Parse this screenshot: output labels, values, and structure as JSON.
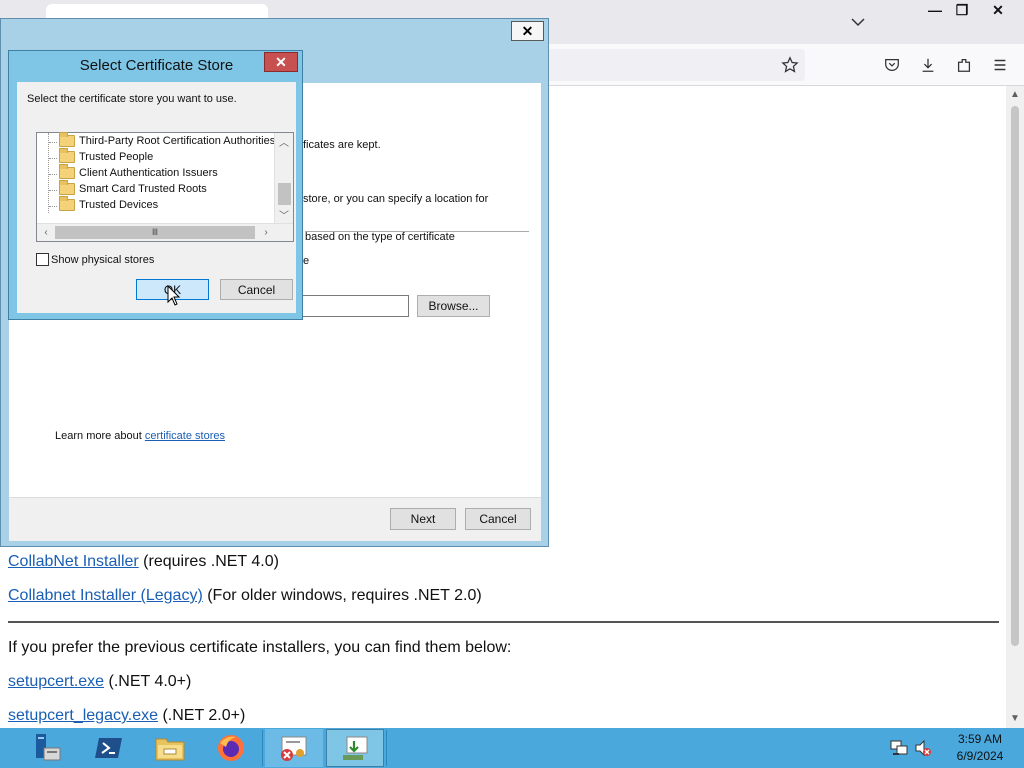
{
  "browser": {
    "window_controls": {
      "minimize": "—",
      "restore": "❐",
      "close": "✕"
    },
    "toolbar_icons": [
      "bookmark-star-icon",
      "pocket-icon",
      "downloads-icon",
      "extensions-icon",
      "menu-icon"
    ]
  },
  "page": {
    "lines": [
      {
        "link": "CollabNet Installer",
        "text": " (requires .NET 4.0)"
      },
      {
        "link": "Collabnet Installer (Legacy)",
        "text": " (For older windows, requires .NET 2.0)"
      },
      {
        "text": "If you prefer the previous certificate installers, you can find them below:"
      },
      {
        "link": "setupcert.exe",
        "text": " (.NET 4.0+)"
      },
      {
        "link": "setupcert_legacy.exe",
        "text": " (.NET 2.0+)"
      }
    ]
  },
  "wizard": {
    "close": "✕",
    "text_kept": "ficates are kept.",
    "text_store": "store, or you can specify a location for",
    "text_based": "based on the type of certificate",
    "text_e": "e",
    "browse_label": "Browse...",
    "learn_more": "Learn more about ",
    "learn_more_link": "certificate stores",
    "next_label": "Next",
    "cancel_label": "Cancel"
  },
  "cert_dialog": {
    "title": "Select Certificate Store",
    "close": "✕",
    "instruction": "Select the certificate store you want to use.",
    "stores": [
      "Third-Party Root Certification Authorities",
      "Trusted People",
      "Client Authentication Issuers",
      "Smart Card Trusted Roots",
      "Trusted Devices"
    ],
    "hscroll_grip": "Ⅲ",
    "show_physical": "Show physical stores",
    "show_physical_checked": false,
    "ok_label": "OK",
    "cancel_label": "Cancel"
  },
  "taskbar": {
    "items": [
      "server-manager-icon",
      "powershell-icon",
      "file-explorer-icon",
      "firefox-icon",
      "certificate-icon",
      "certificate-import-icon"
    ],
    "time": "3:59 AM",
    "date": "6/9/2024"
  },
  "colors": {
    "accent": "#4aa8dc",
    "dialog_frame": "#7fc5e6",
    "link": "#1a5fb4",
    "close_red": "#c75050"
  }
}
